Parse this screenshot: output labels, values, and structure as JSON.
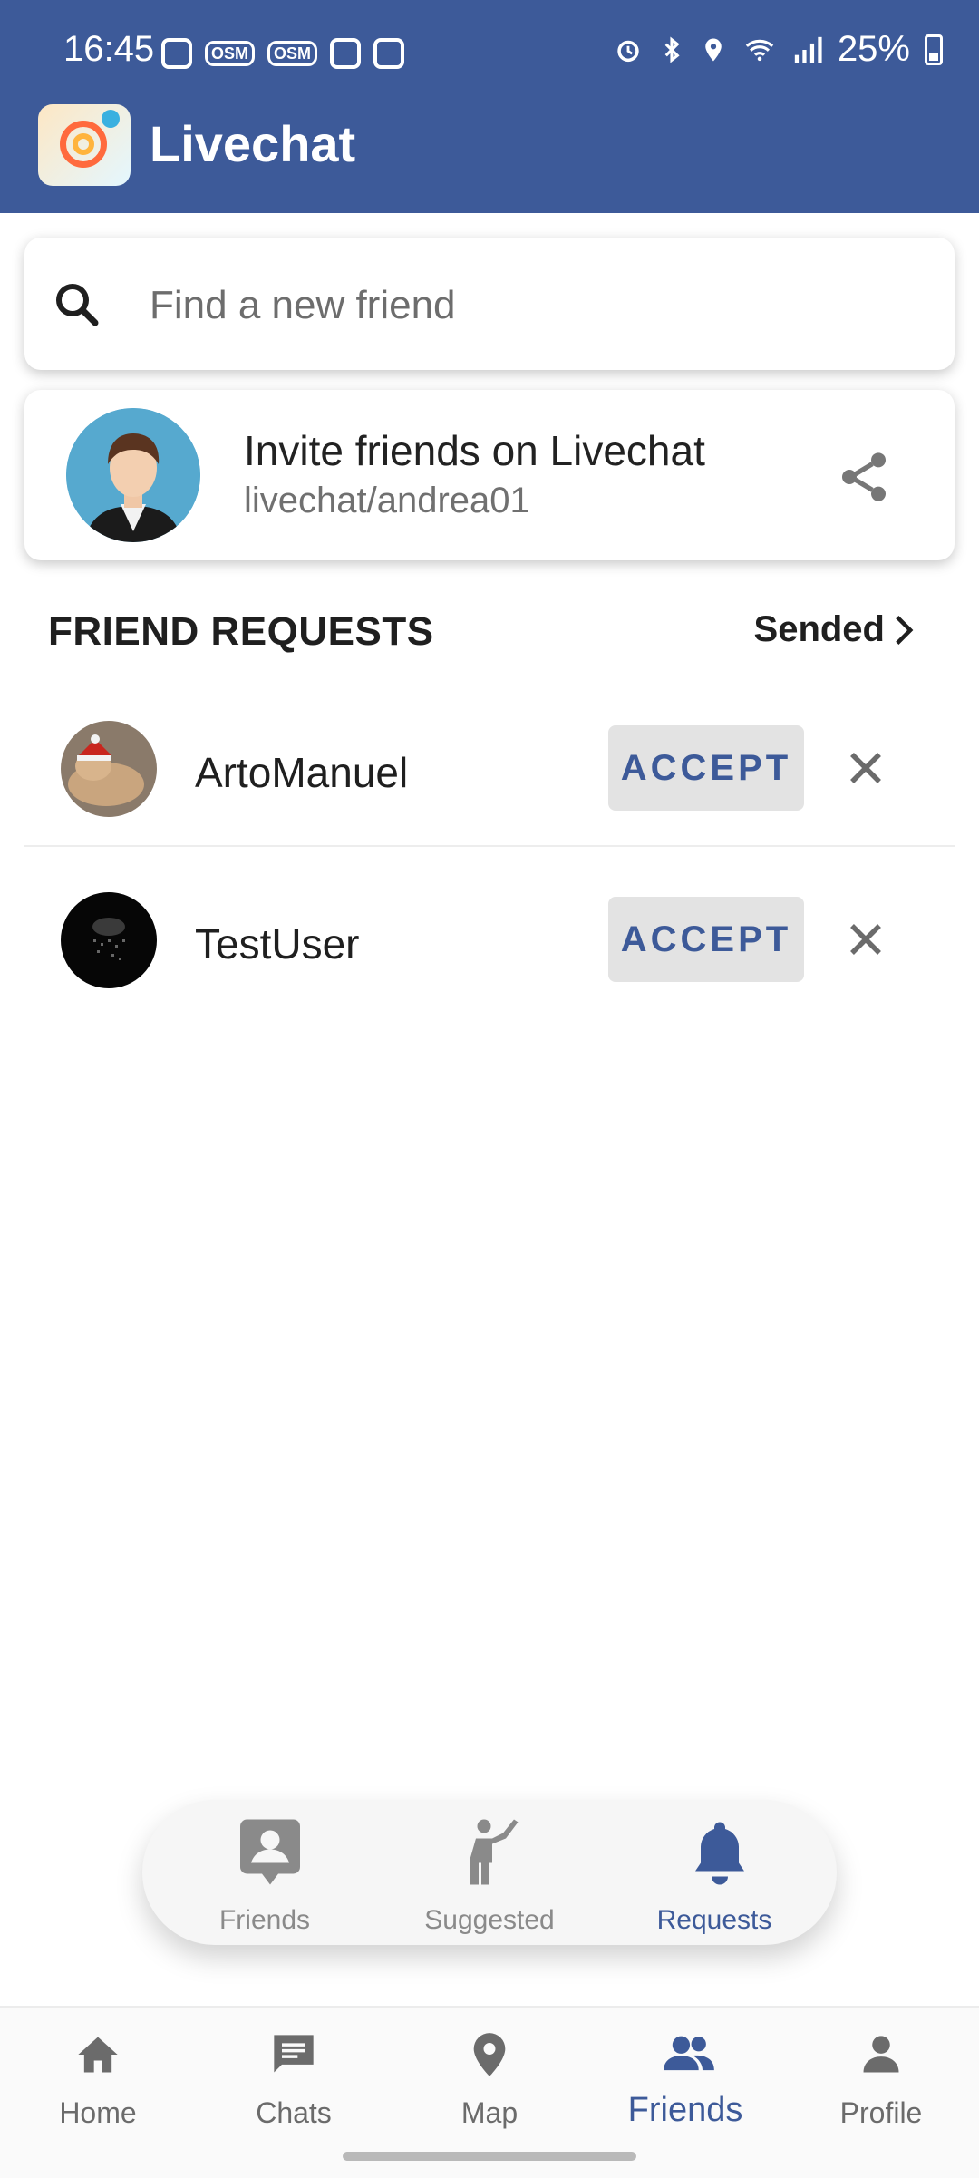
{
  "status_bar": {
    "time": "16:45",
    "battery": "25%",
    "left_icons": [
      "instagram-icon",
      "osm-icon",
      "osm-icon",
      "clock-app-icon",
      "gallery-icon"
    ],
    "right_icons": [
      "alarm-icon",
      "bluetooth-icon",
      "location-icon",
      "wifi-icon",
      "signal-icon",
      "battery-icon"
    ]
  },
  "app_bar": {
    "title": "Livechat",
    "color": "#3d5a99"
  },
  "search": {
    "placeholder": "Find a new friend"
  },
  "invite": {
    "title": "Invite friends on Livechat",
    "link": "livechat/andrea01"
  },
  "requests": {
    "title": "FRIEND REQUESTS",
    "sent_link": "Sended",
    "items": [
      {
        "name": "ArtoManuel",
        "accept_label": "ACCEPT"
      },
      {
        "name": "TestUser",
        "accept_label": "ACCEPT"
      }
    ]
  },
  "friend_tabs": {
    "items": [
      {
        "label": "Friends",
        "icon": "contact-card-icon",
        "active": false
      },
      {
        "label": "Suggested",
        "icon": "person-waving-icon",
        "active": false
      },
      {
        "label": "Requests",
        "icon": "bell-icon",
        "active": true
      }
    ]
  },
  "bottom_nav": {
    "items": [
      {
        "label": "Home",
        "icon": "home-icon",
        "active": false
      },
      {
        "label": "Chats",
        "icon": "chat-icon",
        "active": false
      },
      {
        "label": "Map",
        "icon": "map-pin-icon",
        "active": false
      },
      {
        "label": "Friends",
        "icon": "group-icon",
        "active": true
      },
      {
        "label": "Profile",
        "icon": "person-icon",
        "active": false
      }
    ]
  },
  "colors": {
    "accent": "#3d5a99",
    "inactive": "#8a8a8a",
    "accept_bg": "#e3e3e3"
  }
}
